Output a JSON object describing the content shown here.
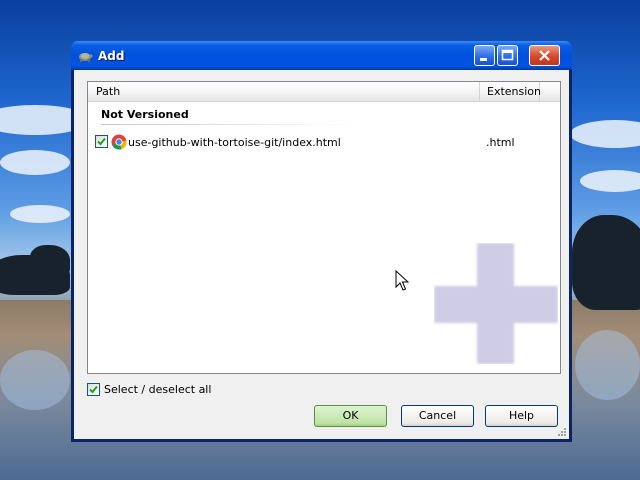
{
  "window": {
    "title": "Add",
    "icon": "tortoise-icon",
    "controls": [
      "minimize-icon",
      "maximize-icon",
      "close-icon"
    ]
  },
  "list": {
    "columns": {
      "path": "Path",
      "extension": "Extension"
    },
    "group": "Not Versioned",
    "items": [
      {
        "checked": true,
        "icon": "chrome-icon",
        "path": "use-github-with-tortoise-git/index.html",
        "extension": ".html"
      }
    ]
  },
  "select_all": {
    "label": "Select / deselect all",
    "checked": true
  },
  "buttons": {
    "ok": "OK",
    "cancel": "Cancel",
    "help": "Help"
  },
  "colors": {
    "titlebar": "#0054e3",
    "default_button": "#bfe3a4",
    "overlay": "#cfcce6"
  }
}
